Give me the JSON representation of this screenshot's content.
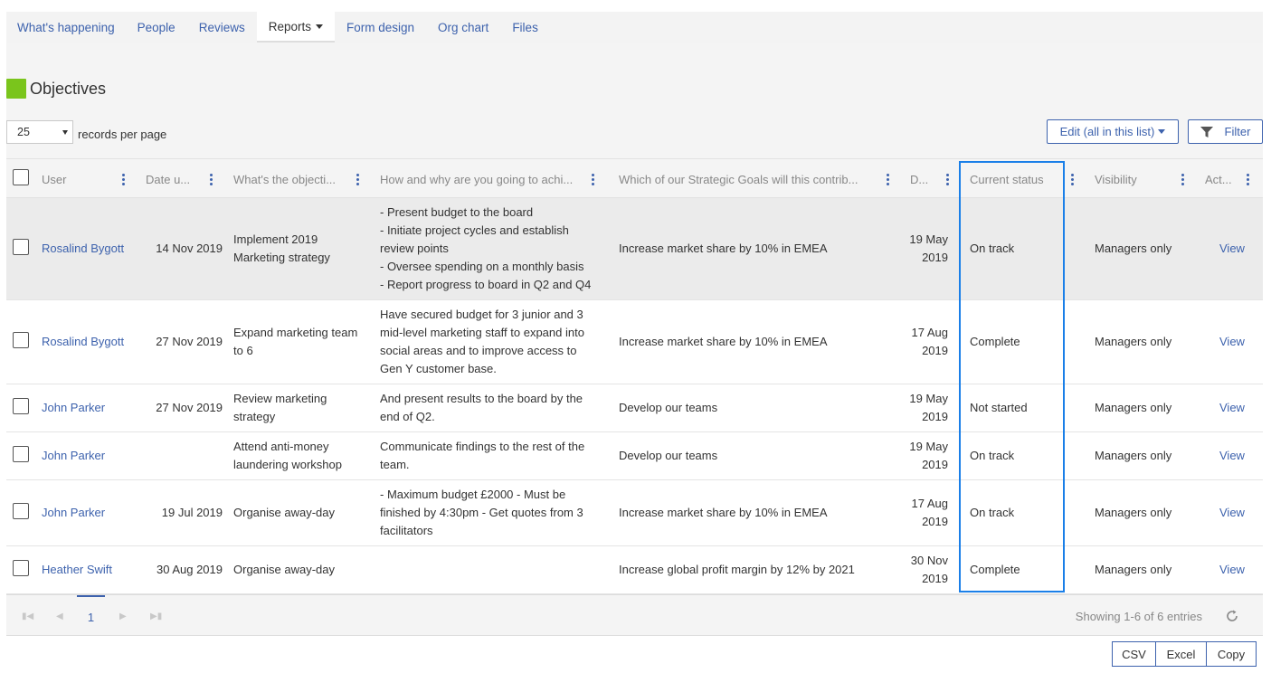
{
  "nav": {
    "tabs": [
      {
        "label": "What's happening"
      },
      {
        "label": "People"
      },
      {
        "label": "Reviews"
      },
      {
        "label": "Reports"
      },
      {
        "label": "Form design"
      },
      {
        "label": "Org chart"
      },
      {
        "label": "Files"
      }
    ],
    "active_tab": "Reports"
  },
  "page": {
    "title": "Objectives",
    "title_icon_color": "#7ac51c"
  },
  "records_per_page": {
    "value": "25",
    "label": "records per page"
  },
  "toolbar": {
    "edit_label": "Edit (all in this list)",
    "filter_label": "Filter"
  },
  "table": {
    "columns": [
      {
        "label": "User"
      },
      {
        "label": "Date u..."
      },
      {
        "label": "What's the objecti..."
      },
      {
        "label": "How and why are you going to achi..."
      },
      {
        "label": "Which of our Strategic Goals will this contrib..."
      },
      {
        "label": "D..."
      },
      {
        "label": "Current status"
      },
      {
        "label": "Visibility"
      },
      {
        "label": "Act..."
      }
    ],
    "rows": [
      {
        "user": "Rosalind Bygott",
        "date": "14 Nov 2019",
        "objective": "Implement 2019 Marketing strategy",
        "how_lines": [
          "- Present budget to the board",
          "- Initiate project cycles and establish",
          "review points",
          "- Oversee spending on a monthly basis",
          "- Report progress to board in Q2 and Q4"
        ],
        "goal": "Increase market share by 10% in EMEA",
        "due_1": "19 May",
        "due_2": "2019",
        "status": "On track",
        "visibility": "Managers only",
        "action": "View"
      },
      {
        "user": "Rosalind Bygott",
        "date": "27 Nov 2019",
        "objective": "Expand marketing team to 6",
        "how_lines": [
          "Have secured budget for 3 junior and 3",
          "mid-level marketing staff to expand into",
          "social areas and to improve access to",
          "Gen Y customer base."
        ],
        "goal": "Increase market share by 10% in EMEA",
        "due_1": "17 Aug",
        "due_2": "2019",
        "status": "Complete",
        "visibility": "Managers only",
        "action": "View"
      },
      {
        "user": "John Parker",
        "date": "27 Nov 2019",
        "objective": "Review marketing strategy",
        "how_lines": [
          "And present results to the board by the",
          "end of Q2."
        ],
        "goal": "Develop our teams",
        "due_1": "19 May",
        "due_2": "2019",
        "status": "Not started",
        "visibility": "Managers only",
        "action": "View"
      },
      {
        "user": "John Parker",
        "date": "",
        "objective": "Attend anti-money laundering workshop",
        "how_lines": [
          "Communicate findings to the rest of the",
          "team."
        ],
        "goal": "Develop our teams",
        "due_1": "19 May",
        "due_2": "2019",
        "status": "On track",
        "visibility": "Managers only",
        "action": "View"
      },
      {
        "user": "John Parker",
        "date": "19 Jul 2019",
        "objective": "Organise away-day",
        "how_lines": [
          "- Maximum budget £2000 - Must be",
          "finished by 4:30pm - Get quotes from 3",
          "facilitators"
        ],
        "goal": "Increase market share by 10% in EMEA",
        "due_1": "17 Aug",
        "due_2": "2019",
        "status": "On track",
        "visibility": "Managers only",
        "action": "View"
      },
      {
        "user": "Heather Swift",
        "date": "30 Aug 2019",
        "objective": "Organise away-day",
        "how_lines": [],
        "goal": "Increase global profit margin by 12% by 2021",
        "due_1": "30 Nov",
        "due_2": "2019",
        "status": "Complete",
        "visibility": "Managers only",
        "action": "View"
      }
    ]
  },
  "pager": {
    "current_page": "1",
    "showing": "Showing 1-6 of 6 entries"
  },
  "export": {
    "csv": "CSV",
    "excel": "Excel",
    "copy": "Copy"
  },
  "colors": {
    "link": "#3d62ad",
    "highlight_box": "#1a7fe8",
    "row_highlight": "#ebebeb"
  }
}
